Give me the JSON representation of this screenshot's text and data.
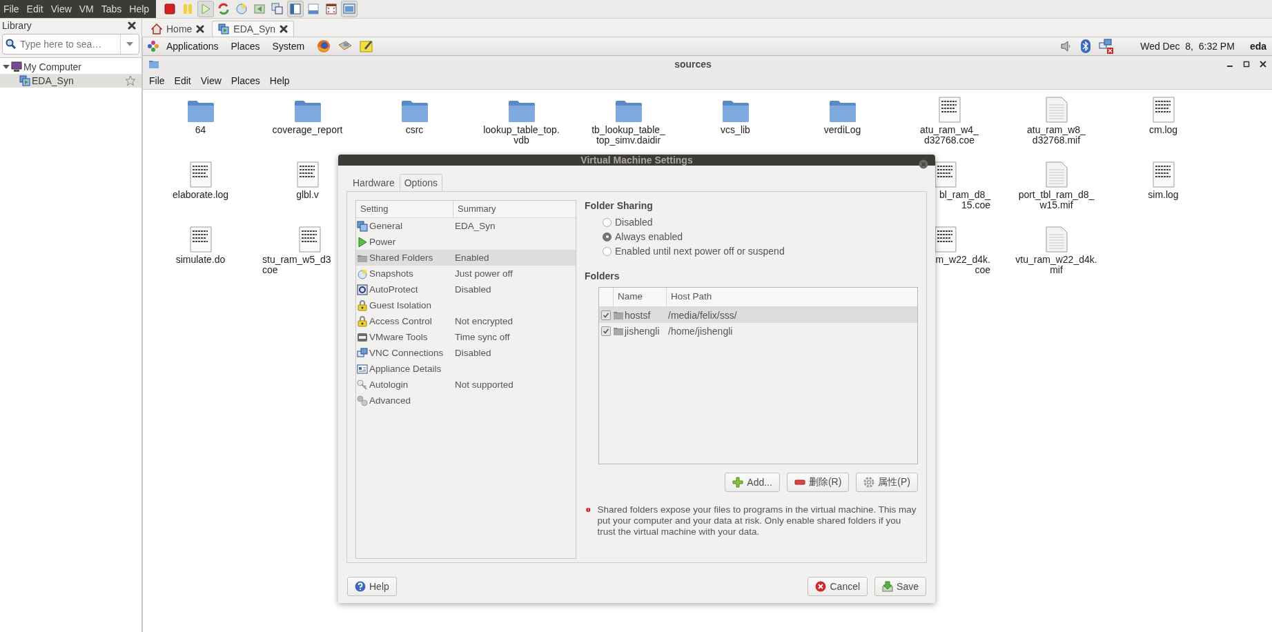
{
  "menubar": {
    "items": [
      "File",
      "Edit",
      "View",
      "VM",
      "Tabs",
      "Help"
    ]
  },
  "toolbar": [
    {
      "kind": "stop",
      "pressed": false
    },
    {
      "kind": "pause",
      "pressed": false
    },
    {
      "kind": "play",
      "pressed": true
    },
    {
      "kind": "reset",
      "pressed": false
    },
    {
      "kind": "snapshot",
      "pressed": false
    },
    {
      "kind": "revert",
      "pressed": false
    },
    {
      "kind": "snapshots",
      "pressed": false
    },
    {
      "kind": "sidebar",
      "pressed": true
    },
    {
      "kind": "bottom-bar",
      "pressed": false
    },
    {
      "kind": "fullscreen",
      "pressed": false
    },
    {
      "kind": "console",
      "pressed": true
    }
  ],
  "library": {
    "title": "Library",
    "search": {
      "placeholder": "Type here to sea…"
    },
    "tree": [
      {
        "label": "My Computer",
        "expanded": true,
        "selected": false,
        "children": [
          {
            "label": "EDA_Syn",
            "selected": true
          }
        ]
      }
    ]
  },
  "tabs": [
    {
      "label": "Home",
      "kind": "home",
      "selected": false
    },
    {
      "label": "EDA_Syn",
      "kind": "vm",
      "selected": true
    }
  ],
  "guest_panel": {
    "menus": [
      "Applications",
      "Places",
      "System"
    ],
    "clock": "Wed Dec  8,  6:32 PM",
    "user": "eda"
  },
  "file_window": {
    "title": "sources",
    "menu": [
      "File",
      "Edit",
      "View",
      "Places",
      "Help"
    ],
    "rows": [
      {
        "left": [
          {
            "kind": "folder",
            "label": "64"
          },
          {
            "kind": "folder",
            "label": "coverage_report"
          },
          {
            "kind": "folder",
            "label": "csrc"
          },
          {
            "kind": "folder",
            "label": "lookup_table_top.\nvdb"
          },
          {
            "kind": "folder",
            "label": "tb_lookup_table_\ntop_simv.daidir"
          },
          {
            "kind": "folder",
            "label": "vcs_lib"
          },
          {
            "kind": "folder",
            "label": "verdiLog"
          },
          {
            "kind": "text",
            "label": "atu_ram_w4_\nd32768.coe"
          },
          {
            "kind": "document",
            "label": "atu_ram_w8_\nd32768.mif"
          },
          {
            "kind": "text",
            "label": "cm.log"
          }
        ],
        "right": []
      },
      {
        "left": [
          {
            "kind": "text",
            "label": "elaborate.log"
          },
          {
            "kind": "text",
            "label": "glbl.v"
          }
        ],
        "right": [
          {
            "kind": "text",
            "label": "bl_ram_d8_\n15.coe",
            "clipped_left": true
          },
          {
            "kind": "document",
            "label": "port_tbl_ram_d8_\nw15.mif"
          },
          {
            "kind": "text",
            "label": "sim.log"
          }
        ]
      },
      {
        "left": [
          {
            "kind": "text",
            "label": "simulate.do"
          },
          {
            "kind": "text",
            "label": "stu_ram_w5_d3\ncoe",
            "clipped_right": true
          }
        ],
        "right": [
          {
            "kind": "text",
            "label": "m_w22_d4k.\ncoe",
            "clipped_left": true
          },
          {
            "kind": "document",
            "label": "vtu_ram_w22_d4k.\nmif"
          }
        ]
      }
    ]
  },
  "dialog": {
    "title": "Virtual Machine Settings",
    "tabs": [
      {
        "label": "Hardware",
        "selected": false
      },
      {
        "label": "Options",
        "selected": true
      }
    ],
    "settings_columns": [
      "Setting",
      "Summary"
    ],
    "settings": [
      {
        "kind": "general",
        "name": "General",
        "summary": "EDA_Syn",
        "selected": false
      },
      {
        "kind": "power",
        "name": "Power",
        "selected": false
      },
      {
        "kind": "shared",
        "name": "Shared Folders",
        "summary": "Enabled",
        "selected": true
      },
      {
        "kind": "snapshots",
        "name": "Snapshots",
        "summary": "Just power off",
        "selected": false
      },
      {
        "kind": "autoprotect",
        "name": "AutoProtect",
        "summary": "Disabled",
        "selected": false
      },
      {
        "kind": "lock",
        "name": "Guest Isolation",
        "selected": false
      },
      {
        "kind": "lock",
        "name": "Access Control",
        "summary": "Not encrypted",
        "selected": false
      },
      {
        "kind": "vmtools",
        "name": "VMware Tools",
        "summary": "Time sync off",
        "selected": false
      },
      {
        "kind": "vnc",
        "name": "VNC Connections",
        "summary": "Disabled",
        "selected": false
      },
      {
        "kind": "appliance",
        "name": "Appliance Details",
        "selected": false
      },
      {
        "kind": "key",
        "name": "Autologin",
        "summary": "Not supported",
        "selected": false
      },
      {
        "kind": "gears",
        "name": "Advanced",
        "selected": false
      }
    ],
    "sharing_heading": "Folder Sharing",
    "sharing_options": [
      {
        "label": "Disabled",
        "selected": false
      },
      {
        "label": "Always enabled",
        "selected": true
      },
      {
        "label": "Enabled until next power off or suspend",
        "selected": false
      }
    ],
    "folders_heading": "Folders",
    "folder_columns": [
      "Name",
      "Host Path"
    ],
    "folders": [
      {
        "name": "hostsf",
        "path": "/media/felix/sss/",
        "checked": true,
        "selected": true
      },
      {
        "name": "jishengli",
        "path": "/home/jishengli",
        "checked": true,
        "selected": false
      }
    ],
    "folder_buttons": [
      {
        "kind": "add",
        "label": "Add..."
      },
      {
        "kind": "remove",
        "label": "删除(R)"
      },
      {
        "kind": "properties",
        "label": "属性(P)"
      }
    ],
    "warning": "Shared folders expose your files to programs in the virtual machine. This may put your computer and your data at risk. Only enable shared folders if you trust the virtual machine with your data.",
    "help_button": "Help",
    "cancel_button": "Cancel",
    "save_button": "Save"
  }
}
